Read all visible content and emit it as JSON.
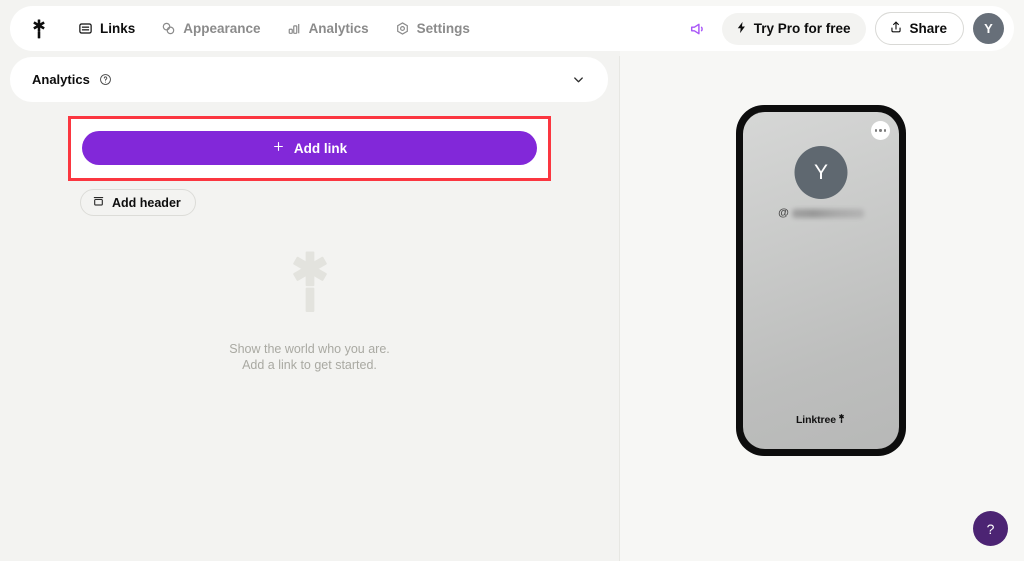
{
  "header": {
    "logo_icon": "linktree-asterisk-logo",
    "nav": [
      {
        "label": "Links",
        "icon": "links-icon",
        "active": true
      },
      {
        "label": "Appearance",
        "icon": "appearance-icon",
        "active": false
      },
      {
        "label": "Analytics",
        "icon": "analytics-icon",
        "active": false
      },
      {
        "label": "Settings",
        "icon": "settings-icon",
        "active": false
      }
    ],
    "megaphone_icon": "megaphone-icon",
    "pro_button": {
      "label": "Try Pro for free",
      "icon": "lightning-bolt-icon"
    },
    "share_button": {
      "label": "Share",
      "icon": "share-upload-icon"
    },
    "avatar": {
      "initial": "Y"
    }
  },
  "analytics_panel": {
    "title": "Analytics",
    "help_icon": "help-circle-icon",
    "chevron_icon": "chevron-down-icon"
  },
  "editor": {
    "add_link": {
      "label": "Add link",
      "icon": "plus-icon"
    },
    "add_header": {
      "label": "Add header",
      "icon": "header-block-icon"
    },
    "empty_state": {
      "logo_icon": "linktree-asterisk-logo-large",
      "line1": "Show the world who you are.",
      "line2": "Add a link to get started."
    }
  },
  "preview": {
    "menu_icon": "three-dots-icon",
    "avatar": {
      "initial": "Y"
    },
    "username": {
      "at_symbol": "@",
      "value": "",
      "redacted": true
    },
    "footer_brand": "Linktree"
  },
  "help_fab": {
    "label": "?"
  },
  "colors": {
    "accent_purple": "#8228d9",
    "highlight_red": "#fb3640",
    "help_fab_purple": "#4c2473",
    "avatar_gray": "#676f79",
    "left_pane_bg": "#f3f3f1",
    "right_pane_bg": "#f7f7f5"
  }
}
